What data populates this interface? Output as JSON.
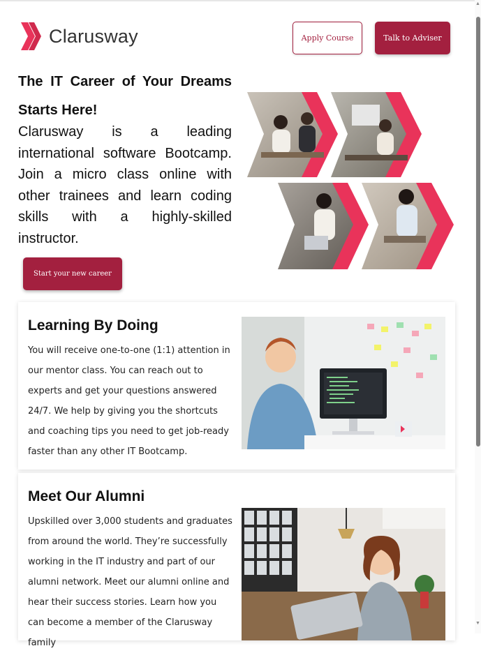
{
  "brand": {
    "name": "Clarusway",
    "accent": "#a3203f",
    "pink": "#e9335a"
  },
  "header": {
    "apply_label": "Apply Course",
    "adviser_label": "Talk to Adviser"
  },
  "hero": {
    "title": "The IT Career of Your Dreams Starts Here!",
    "text": "Clarusway is a leading international software Bootcamp. Join a micro class online with other trainees and learn coding skills with a highly-skilled instructor.",
    "cta_label": "Start your new career"
  },
  "sections": [
    {
      "title": "Learning By Doing",
      "text": "You will receive one-to-one (1:1) attention in our mentor class. You can reach out to experts and get your questions answered 24/7. We help by giving you the shortcuts and coaching tips you need to get job-ready faster than any other IT Bootcamp."
    },
    {
      "title": "Meet Our Alumni",
      "text": "Upskilled over 3,000 students and graduates from around the world. They’re successfully working in the IT industry and part of our alumni network. Meet our alumni online and hear their success stories. Learn how you can become a member of the Clarusway family"
    }
  ],
  "icons": [
    "clarusway-logo-icon",
    "scroll-up-icon",
    "scroll-down-icon"
  ]
}
